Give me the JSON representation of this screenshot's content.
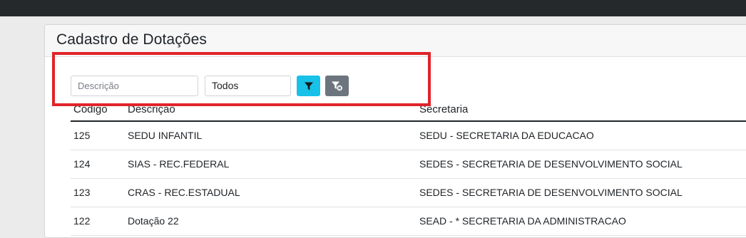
{
  "page": {
    "title": "Cadastro de Dotações"
  },
  "filters": {
    "description_placeholder": "Descrição",
    "status_selected": "Todos",
    "filter_button_icon": "filter-icon",
    "clear_button_icon": "filter-clear-icon",
    "filter_button_color": "#17c1e8",
    "clear_button_color": "#6c757d"
  },
  "highlight_color": "#e0242a",
  "table": {
    "columns": [
      "Código",
      "Descrição",
      "Secretaria"
    ],
    "rows": [
      [
        "125",
        "SEDU INFANTIL",
        "SEDU - SECRETARIA DA EDUCACAO"
      ],
      [
        "124",
        "SIAS - REC.FEDERAL",
        "SEDES - SECRETARIA DE DESENVOLVIMENTO SOCIAL"
      ],
      [
        "123",
        "CRAS - REC.ESTADUAL",
        "SEDES - SECRETARIA DE DESENVOLVIMENTO SOCIAL"
      ],
      [
        "122",
        "Dotação 22",
        "SEAD - * SECRETARIA DA ADMINISTRACAO"
      ]
    ]
  }
}
